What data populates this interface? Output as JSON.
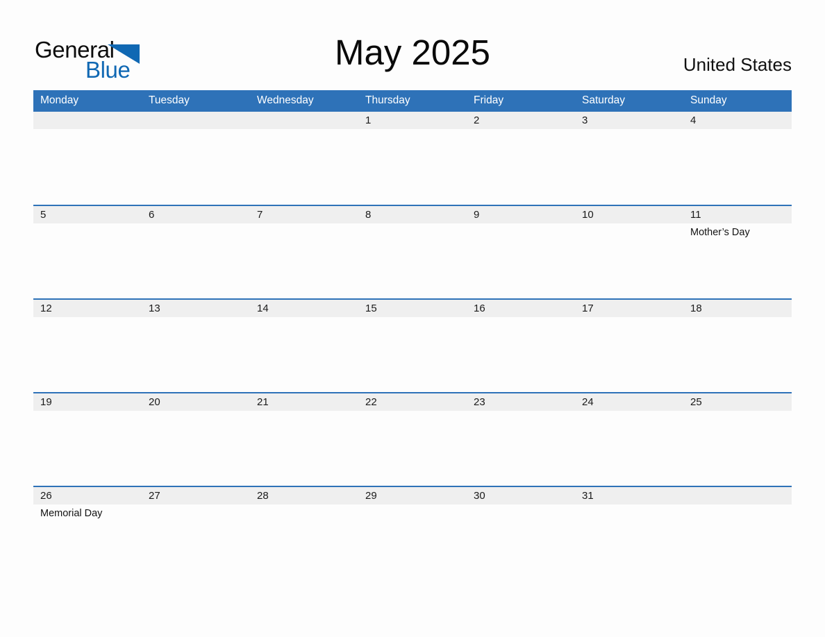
{
  "brand": {
    "name_part1": "General",
    "name_part2": "Blue",
    "triangle_icon": "triangle-icon",
    "color_black": "#0d0d0d",
    "color_blue": "#1068b3"
  },
  "header": {
    "title": "May 2025",
    "country": "United States"
  },
  "theme": {
    "header_blue": "#2e72b8",
    "band_gray": "#efefef",
    "page_bg": "#fdfdfd",
    "rule_blue": "#2e72b8"
  },
  "calendar": {
    "month": "May",
    "year": "2025",
    "weekday_headers": [
      "Monday",
      "Tuesday",
      "Wednesday",
      "Thursday",
      "Friday",
      "Saturday",
      "Sunday"
    ],
    "weeks": [
      {
        "days": [
          {
            "num": "",
            "events": []
          },
          {
            "num": "",
            "events": []
          },
          {
            "num": "",
            "events": []
          },
          {
            "num": "1",
            "events": []
          },
          {
            "num": "2",
            "events": []
          },
          {
            "num": "3",
            "events": []
          },
          {
            "num": "4",
            "events": []
          }
        ]
      },
      {
        "days": [
          {
            "num": "5",
            "events": []
          },
          {
            "num": "6",
            "events": []
          },
          {
            "num": "7",
            "events": []
          },
          {
            "num": "8",
            "events": []
          },
          {
            "num": "9",
            "events": []
          },
          {
            "num": "10",
            "events": []
          },
          {
            "num": "11",
            "events": [
              "Mother’s Day"
            ]
          }
        ]
      },
      {
        "days": [
          {
            "num": "12",
            "events": []
          },
          {
            "num": "13",
            "events": []
          },
          {
            "num": "14",
            "events": []
          },
          {
            "num": "15",
            "events": []
          },
          {
            "num": "16",
            "events": []
          },
          {
            "num": "17",
            "events": []
          },
          {
            "num": "18",
            "events": []
          }
        ]
      },
      {
        "days": [
          {
            "num": "19",
            "events": []
          },
          {
            "num": "20",
            "events": []
          },
          {
            "num": "21",
            "events": []
          },
          {
            "num": "22",
            "events": []
          },
          {
            "num": "23",
            "events": []
          },
          {
            "num": "24",
            "events": []
          },
          {
            "num": "25",
            "events": []
          }
        ]
      },
      {
        "days": [
          {
            "num": "26",
            "events": [
              "Memorial Day"
            ]
          },
          {
            "num": "27",
            "events": []
          },
          {
            "num": "28",
            "events": []
          },
          {
            "num": "29",
            "events": []
          },
          {
            "num": "30",
            "events": []
          },
          {
            "num": "31",
            "events": []
          },
          {
            "num": "",
            "events": []
          }
        ]
      }
    ]
  }
}
